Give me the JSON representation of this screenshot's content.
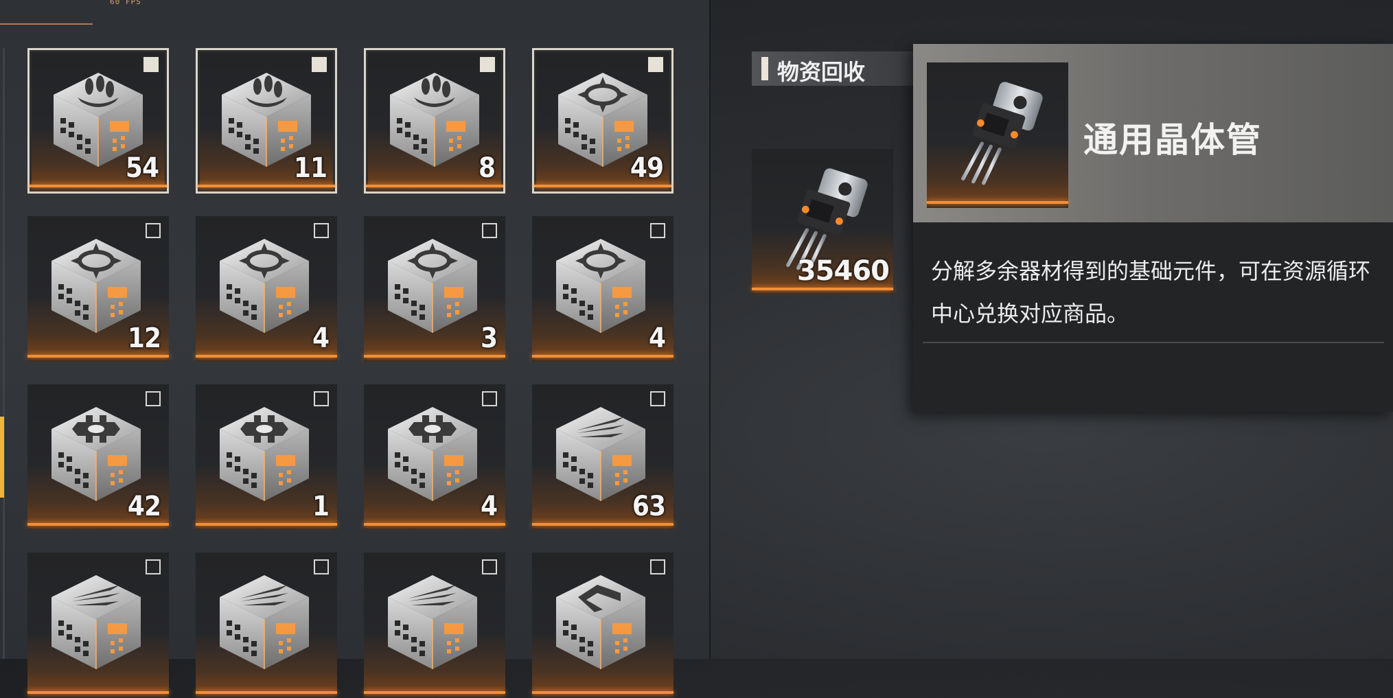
{
  "hud": {
    "fps": "60 FPS"
  },
  "inventory": {
    "items": [
      {
        "count": "54",
        "icon": "cube-missile-icon",
        "selected": true
      },
      {
        "count": "11",
        "icon": "cube-missile-icon",
        "selected": true
      },
      {
        "count": "8",
        "icon": "cube-missile-icon",
        "selected": true
      },
      {
        "count": "49",
        "icon": "cube-crosshair-icon",
        "selected": true
      },
      {
        "count": "12",
        "icon": "cube-crosshair-icon",
        "selected": false
      },
      {
        "count": "4",
        "icon": "cube-crosshair-icon",
        "selected": false
      },
      {
        "count": "3",
        "icon": "cube-crosshair-icon",
        "selected": false
      },
      {
        "count": "4",
        "icon": "cube-crosshair-icon",
        "selected": false
      },
      {
        "count": "42",
        "icon": "cube-gear-icon",
        "selected": false
      },
      {
        "count": "1",
        "icon": "cube-gear-icon",
        "selected": false
      },
      {
        "count": "4",
        "icon": "cube-gear-icon",
        "selected": false
      },
      {
        "count": "63",
        "icon": "cube-wing-icon",
        "selected": false
      },
      {
        "count": "",
        "icon": "cube-wing-icon",
        "selected": false
      },
      {
        "count": "",
        "icon": "cube-wing-icon",
        "selected": false
      },
      {
        "count": "",
        "icon": "cube-wing-icon",
        "selected": false
      },
      {
        "count": "",
        "icon": "cube-chevron-icon",
        "selected": false
      }
    ]
  },
  "recycle": {
    "title": "物资回收",
    "reward_count": "35460",
    "reward_icon": "transistor-icon"
  },
  "tooltip": {
    "name": "通用晶体管",
    "description": "分解多余器材得到的基础元件，可在资源循环中心兑换对应商品。",
    "icon": "transistor-icon"
  },
  "colors": {
    "accent": "#f0903a",
    "highlight": "#f0b43a",
    "frame": "#dcd7cc"
  }
}
